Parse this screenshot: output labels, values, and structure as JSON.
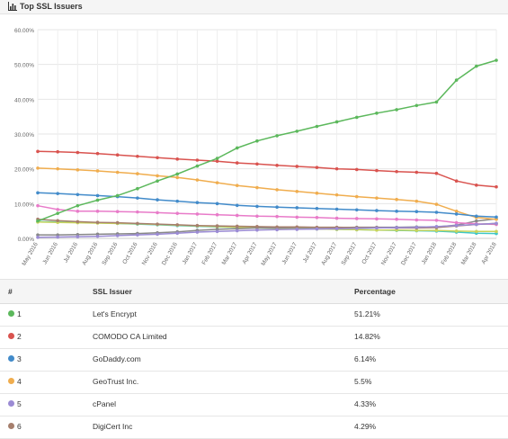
{
  "header": {
    "title": "Top SSL Issuers"
  },
  "chart_data": {
    "type": "line",
    "title": "",
    "xlabel": "",
    "ylabel": "",
    "ylim": [
      0,
      60
    ],
    "yticks": [
      "0.00%",
      "10.00%",
      "20.00%",
      "30.00%",
      "40.00%",
      "50.00%",
      "60.00%"
    ],
    "grid": true,
    "categories": [
      "May 2016",
      "Jun 2016",
      "Jul 2016",
      "Aug 2016",
      "Sep 2016",
      "Oct 2016",
      "Nov 2016",
      "Dec 2016",
      "Jan 2017",
      "Feb 2017",
      "Mar 2017",
      "Apr 2017",
      "May 2017",
      "Jun 2017",
      "Jul 2017",
      "Aug 2017",
      "Sep 2017",
      "Oct 2017",
      "Nov 2017",
      "Dec 2017",
      "Jan 2018",
      "Feb 2018",
      "Mar 2018",
      "Apr 2018"
    ],
    "series": [
      {
        "name": "Let's Encrypt",
        "color": "#5cb85c",
        "values": [
          5.0,
          7.2,
          9.4,
          11.0,
          12.3,
          14.3,
          16.5,
          18.5,
          20.8,
          23.0,
          26.0,
          28.0,
          29.5,
          30.8,
          32.2,
          33.5,
          34.8,
          36.0,
          37.0,
          38.2,
          39.2,
          45.5,
          49.5,
          51.21
        ]
      },
      {
        "name": "COMODO CA Limited",
        "color": "#d9534f",
        "values": [
          25.0,
          24.9,
          24.7,
          24.4,
          24.0,
          23.6,
          23.2,
          22.8,
          22.5,
          22.2,
          21.7,
          21.4,
          21.0,
          20.7,
          20.4,
          20.0,
          19.8,
          19.5,
          19.2,
          19.0,
          18.7,
          16.5,
          15.3,
          14.82
        ]
      },
      {
        "name": "GoDaddy.com",
        "color": "#428bca",
        "values": [
          13.1,
          12.9,
          12.6,
          12.3,
          12.0,
          11.6,
          11.1,
          10.7,
          10.3,
          10.0,
          9.5,
          9.2,
          9.0,
          8.8,
          8.6,
          8.4,
          8.2,
          8.0,
          7.8,
          7.7,
          7.5,
          7.0,
          6.4,
          6.14
        ]
      },
      {
        "name": "GeoTrust Inc.",
        "color": "#f0ad4e",
        "values": [
          20.2,
          20.0,
          19.7,
          19.4,
          19.0,
          18.6,
          18.0,
          17.5,
          16.8,
          16.0,
          15.2,
          14.6,
          14.0,
          13.5,
          13.0,
          12.5,
          12.0,
          11.6,
          11.2,
          10.7,
          9.8,
          7.8,
          6.0,
          5.5
        ]
      },
      {
        "name": "cPanel",
        "color": "#9b8bd4",
        "values": [
          0.3,
          0.4,
          0.5,
          0.6,
          0.8,
          1.0,
          1.2,
          1.5,
          1.8,
          2.0,
          2.2,
          2.4,
          2.5,
          2.6,
          2.7,
          2.8,
          2.9,
          3.0,
          3.1,
          3.2,
          3.4,
          3.7,
          4.0,
          4.33
        ]
      },
      {
        "name": "DigiCert Inc",
        "color": "#a67f6d",
        "values": [
          5.5,
          5.1,
          4.8,
          4.6,
          4.5,
          4.3,
          4.1,
          3.9,
          3.7,
          3.6,
          3.5,
          3.4,
          3.3,
          3.3,
          3.2,
          3.2,
          3.1,
          3.1,
          3.0,
          3.0,
          3.1,
          3.6,
          4.0,
          4.29
        ]
      },
      {
        "name": "",
        "color": "#e87bc9",
        "values": [
          9.4,
          8.3,
          7.8,
          7.8,
          7.7,
          7.6,
          7.4,
          7.2,
          7.0,
          6.8,
          6.6,
          6.4,
          6.3,
          6.1,
          6.0,
          5.8,
          5.7,
          5.6,
          5.5,
          5.3,
          5.2,
          4.5,
          4.2,
          4.0
        ]
      },
      {
        "name": "",
        "color": "#888888",
        "values": [
          1.0,
          1.0,
          1.1,
          1.2,
          1.3,
          1.4,
          1.6,
          1.9,
          2.3,
          2.6,
          2.8,
          3.0,
          3.0,
          3.1,
          3.1,
          3.1,
          3.2,
          3.2,
          3.2,
          3.3,
          3.3,
          3.8,
          5.0,
          5.6
        ]
      },
      {
        "name": "",
        "color": "#c8d45a",
        "values": [
          4.7,
          4.6,
          4.5,
          4.4,
          4.3,
          4.2,
          4.0,
          3.8,
          3.6,
          3.4,
          3.2,
          3.0,
          2.9,
          2.8,
          2.7,
          2.6,
          2.5,
          2.4,
          2.4,
          2.3,
          2.3,
          2.1,
          2.0,
          2.0
        ]
      },
      {
        "name": "",
        "color": "#3dc7c7",
        "values": [
          4.8,
          4.7,
          4.6,
          4.5,
          4.3,
          4.1,
          3.9,
          3.7,
          3.5,
          3.3,
          3.2,
          3.0,
          2.9,
          2.8,
          2.7,
          2.6,
          2.5,
          2.4,
          2.3,
          2.2,
          2.1,
          1.8,
          1.5,
          1.4
        ]
      }
    ]
  },
  "table": {
    "headers": {
      "rank": "#",
      "issuer": "SSL Issuer",
      "percentage": "Percentage"
    },
    "rows": [
      {
        "rank": "1",
        "issuer": "Let's Encrypt",
        "percentage": "51.21%",
        "color": "#5cb85c"
      },
      {
        "rank": "2",
        "issuer": "COMODO CA Limited",
        "percentage": "14.82%",
        "color": "#d9534f"
      },
      {
        "rank": "3",
        "issuer": "GoDaddy.com",
        "percentage": "6.14%",
        "color": "#428bca"
      },
      {
        "rank": "4",
        "issuer": "GeoTrust Inc.",
        "percentage": "5.5%",
        "color": "#f0ad4e"
      },
      {
        "rank": "5",
        "issuer": "cPanel",
        "percentage": "4.33%",
        "color": "#9b8bd4"
      },
      {
        "rank": "6",
        "issuer": "DigiCert Inc",
        "percentage": "4.29%",
        "color": "#a67f6d"
      }
    ]
  }
}
